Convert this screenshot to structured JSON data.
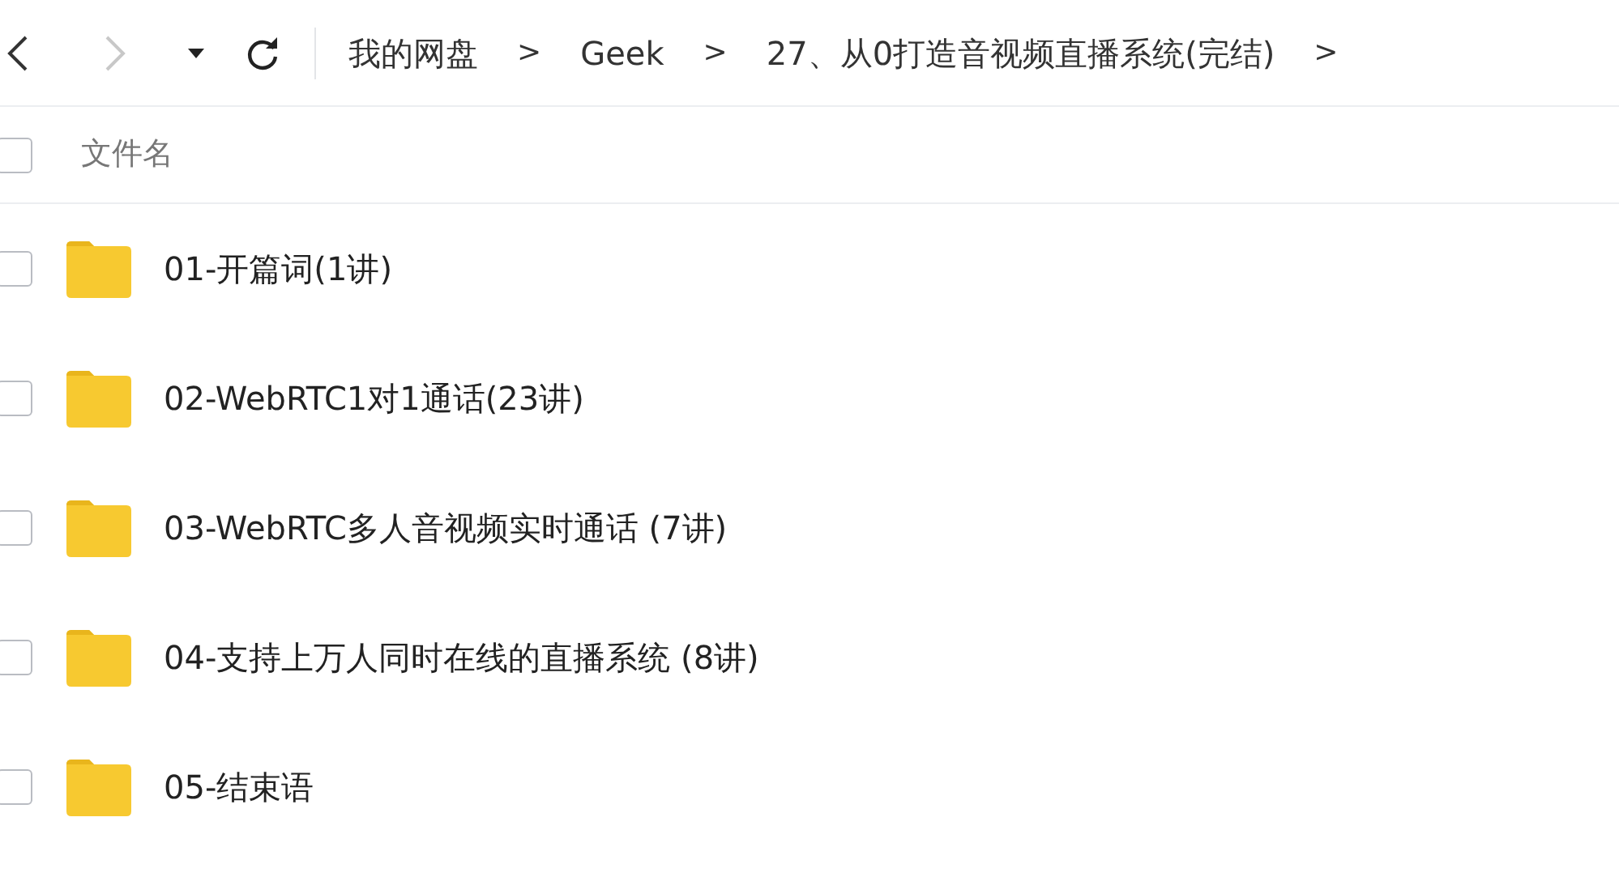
{
  "toolbar": {
    "back": {
      "disabled": false
    },
    "forward": {
      "disabled": true
    }
  },
  "breadcrumbs": [
    {
      "label": "我的网盘",
      "separator": ">"
    },
    {
      "label": "Geek",
      "separator": ">"
    },
    {
      "label": "27、从0打造音视频直播系统(完结)",
      "separator": ">"
    }
  ],
  "header": {
    "checked": false,
    "column": "文件名"
  },
  "files": [
    {
      "name": "01-开篇词(1讲)",
      "kind": "folder",
      "checked": false
    },
    {
      "name": "02-WebRTC1对1通话(23讲)",
      "kind": "folder",
      "checked": false
    },
    {
      "name": "03-WebRTC多人音视频实时通话 (7讲)",
      "kind": "folder",
      "checked": false
    },
    {
      "name": "04-支持上万人同时在线的直播系统 (8讲)",
      "kind": "folder",
      "checked": false
    },
    {
      "name": "05-结束语",
      "kind": "folder",
      "checked": false
    }
  ]
}
